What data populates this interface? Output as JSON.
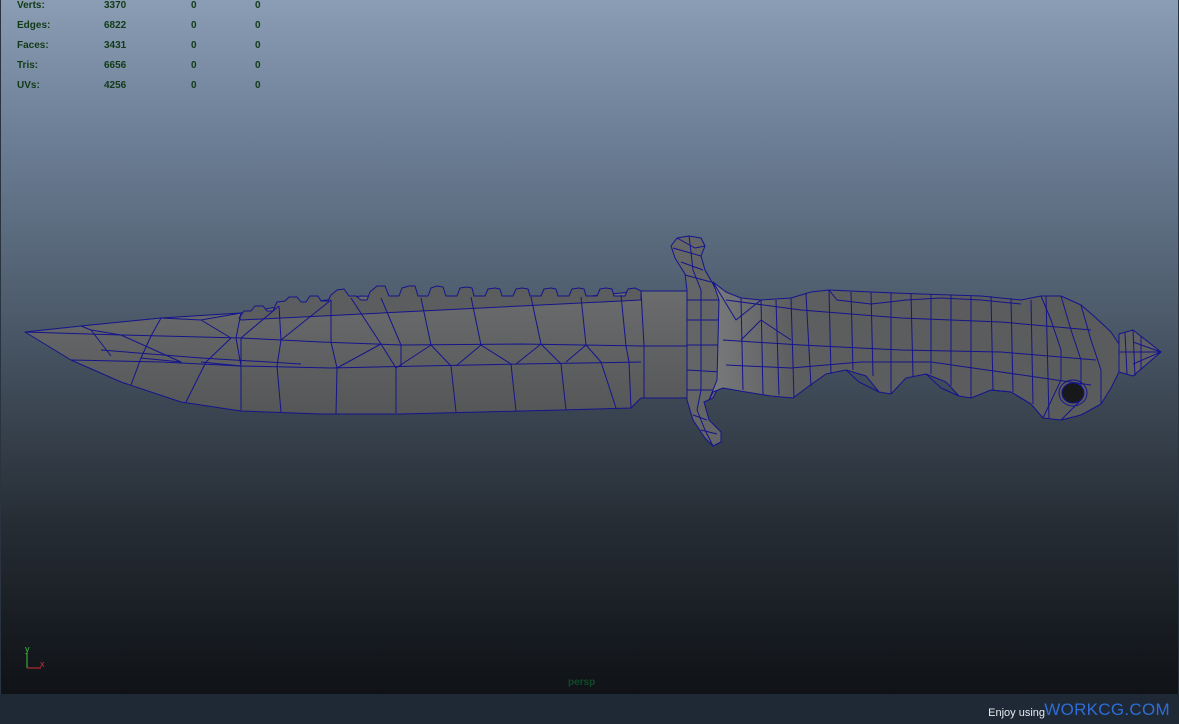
{
  "hud": {
    "rows": [
      {
        "label": "Verts:",
        "v1": "3370",
        "v2": "0",
        "v3": "0"
      },
      {
        "label": "Edges:",
        "v1": "6822",
        "v2": "0",
        "v3": "0"
      },
      {
        "label": "Faces:",
        "v1": "3431",
        "v2": "0",
        "v3": "0"
      },
      {
        "label": "Tris:",
        "v1": "6656",
        "v2": "0",
        "v3": "0"
      },
      {
        "label": "UVs:",
        "v1": "4256",
        "v2": "0",
        "v3": "0"
      }
    ]
  },
  "axis": {
    "y_label": "y",
    "x_label": "x"
  },
  "viewport": {
    "camera_label": "persp"
  },
  "footer": {
    "text": "Enjoy using",
    "brand": "WORKCG.COM"
  },
  "colors": {
    "wireframe": "#14148c",
    "mesh_fill": "#5f6061",
    "hud_text": "#123a16",
    "brand": "#2e6dd6"
  }
}
